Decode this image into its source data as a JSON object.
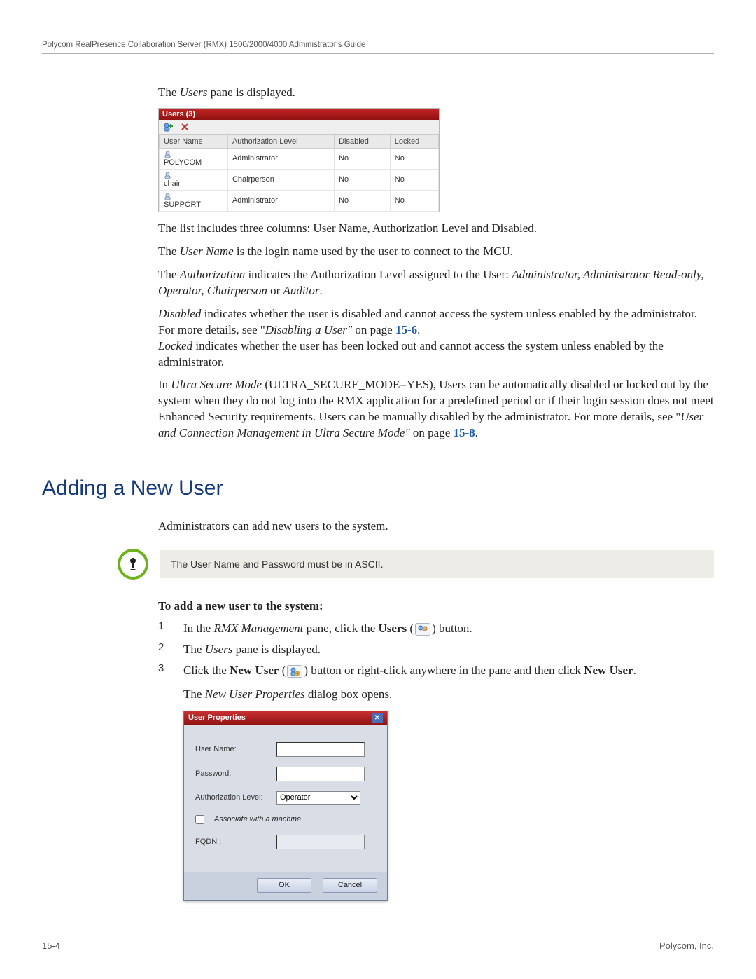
{
  "header": {
    "running_title": "Polycom RealPresence Collaboration Server (RMX) 1500/2000/4000 Administrator's Guide"
  },
  "intro": {
    "pane_displayed_pre": "The ",
    "pane_displayed_em": "Users",
    "pane_displayed_post": " pane is displayed."
  },
  "users_pane": {
    "title": "Users (3)",
    "columns": [
      "User Name",
      "Authorization Level",
      "Disabled",
      "Locked"
    ],
    "rows": [
      {
        "name": "POLYCOM",
        "auth": "Administrator",
        "disabled": "No",
        "locked": "No"
      },
      {
        "name": "chair",
        "auth": "Chairperson",
        "disabled": "No",
        "locked": "No"
      },
      {
        "name": "SUPPORT",
        "auth": "Administrator",
        "disabled": "No",
        "locked": "No"
      }
    ]
  },
  "para": {
    "columns": "The list includes three columns: User Name, Authorization Level and Disabled.",
    "username_pre": "The ",
    "username_em": "User Name",
    "username_post": " is the login name used by the user to connect to the MCU.",
    "authorization_pre": "The ",
    "authorization_em": "Authorization",
    "authorization_mid": " indicates the Authorization Level assigned to the User: ",
    "authorization_roles": "Administrator, Administrator Read-only, Operator, Chairperson",
    "authorization_or": " or ",
    "authorization_auditor": "Auditor",
    "authorization_end": ".",
    "disabled_em": "Disabled",
    "disabled_txt": " indicates whether the user is disabled and cannot access the system unless enabled by the administrator. For more details, see \"",
    "disabled_ref_em": "Disabling a User\"",
    "disabled_onpage": " on page ",
    "disabled_page": "15-6",
    "disabled_end": ".",
    "locked_em": "Locked",
    "locked_txt": " indicates whether the user has been locked out and cannot access the system unless enabled by the administrator.",
    "ultra_pre": "In ",
    "ultra_em": "Ultra Secure Mode",
    "ultra_txt": " (ULTRA_SECURE_MODE=YES), Users can be automatically disabled or locked out by the system when they do not log into the RMX application for a predefined period or if their login session does not meet Enhanced Security requirements. Users can be manually disabled by the administrator. For more details, see \"",
    "ultra_ref_em": "User and Connection Management in Ultra Secure Mode\"",
    "ultra_onpage": " on page ",
    "ultra_page": "15-8",
    "ultra_end": "."
  },
  "heading": "Adding a New User",
  "adding": {
    "intro": "Administrators can add new users to the system.",
    "note": "The User Name and Password must be in ASCII.",
    "subhead": "To add a new user to the system:",
    "steps": {
      "s1_pre": "In the ",
      "s1_em": "RMX Management",
      "s1_mid": " pane, click the ",
      "s1_bold": "Users",
      "s1_open": " (",
      "s1_close": ") button.",
      "s2_pre": "The ",
      "s2_em": "Users",
      "s2_post": " pane is displayed.",
      "s3_pre": "Click the ",
      "s3_bold": "New User",
      "s3_open": " (",
      "s3_mid": ") button or right-click anywhere in the pane and then click ",
      "s3_bold2": "New User",
      "s3_end": ".",
      "s3b_pre": "The ",
      "s3b_em": "New User Properties",
      "s3b_post": " dialog box opens."
    },
    "nums": {
      "n1": "1",
      "n2": "2",
      "n3": "3"
    }
  },
  "dialog": {
    "title": "User Properties",
    "labels": {
      "user": "User Name:",
      "password": "Password:",
      "auth": "Authorization Level:",
      "assoc": "Associate with a machine",
      "fqdn": "FQDN :"
    },
    "auth_value": "Operator",
    "buttons": {
      "ok": "OK",
      "cancel": "Cancel"
    }
  },
  "footer": {
    "page": "15-4",
    "company": "Polycom, Inc."
  }
}
